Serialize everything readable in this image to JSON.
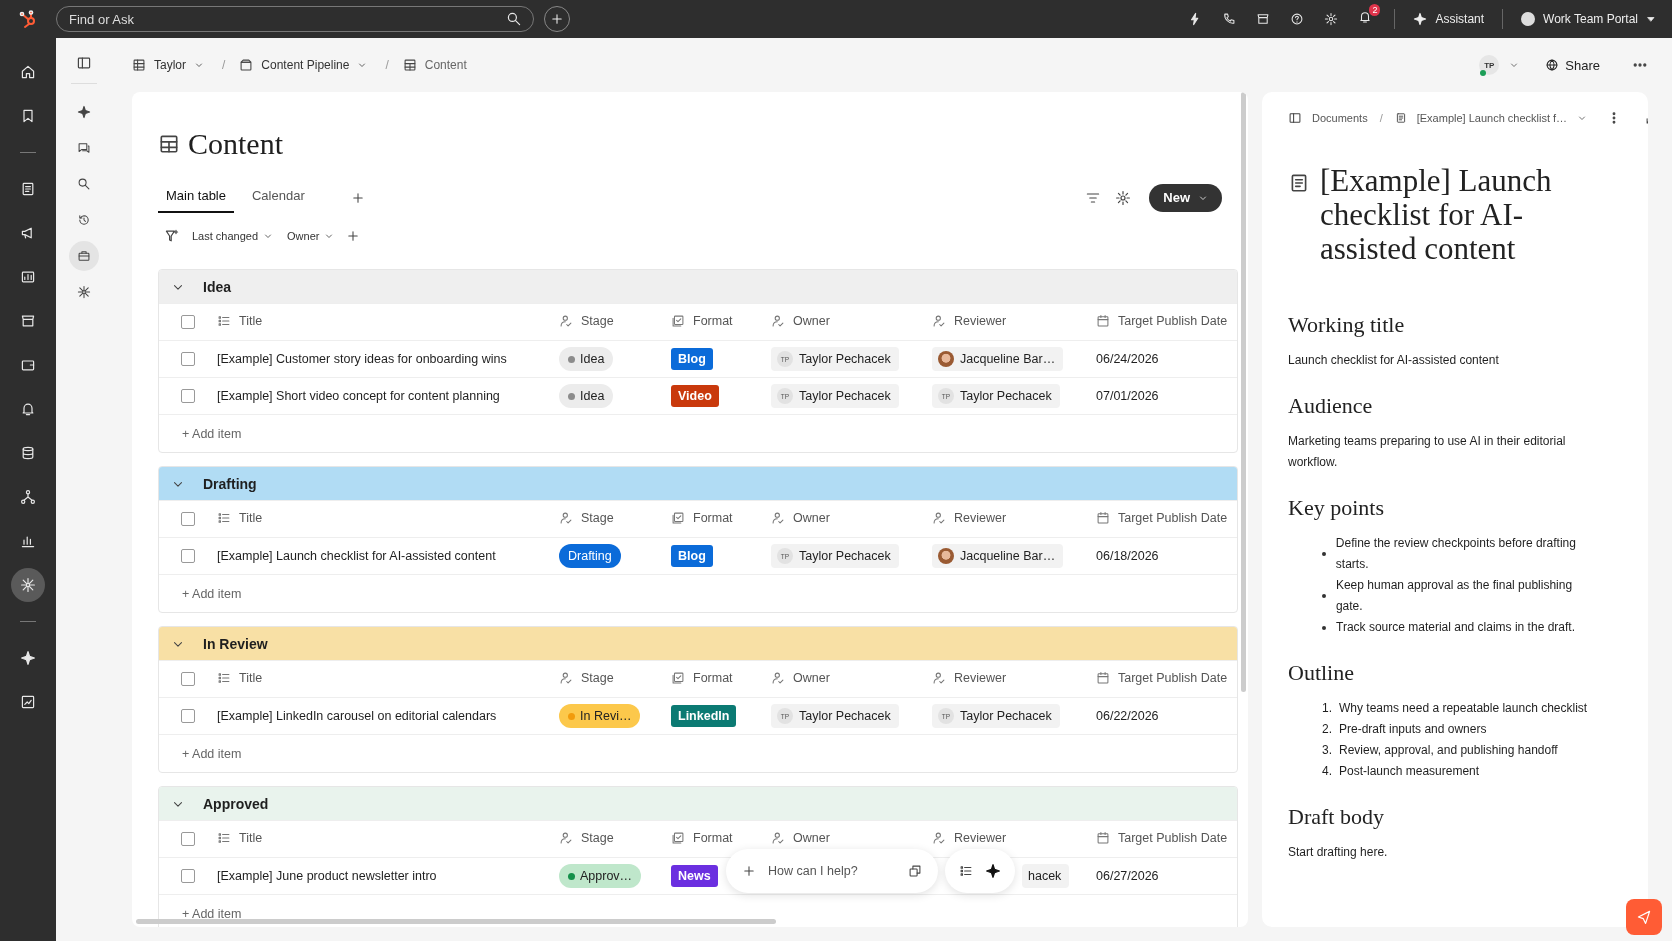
{
  "topbar": {
    "search_placeholder": "Find or Ask",
    "notification_count": "2",
    "assistant": "Assistant",
    "portal": "Work Team Portal"
  },
  "breadcrumb": [
    {
      "label": "Taylor",
      "dropdown": true
    },
    {
      "separator": "/",
      "label": "Content Pipeline",
      "dropdown": true
    },
    {
      "separator": "/",
      "label": "Content",
      "dropdown": false
    }
  ],
  "header": {
    "avatar": "TP",
    "share": "Share"
  },
  "page": {
    "title": "Content"
  },
  "tabs": [
    {
      "label": "Main table",
      "selected": true
    },
    {
      "label": "Calendar",
      "selected": false
    }
  ],
  "new_button": "New",
  "filters": [
    "Last changed",
    "Owner"
  ],
  "groups": [
    {
      "name": "Idea",
      "color": "#efefef",
      "expanded": true,
      "all_checked": false,
      "columns": [
        "Title",
        "Stage",
        "Format",
        "Owner",
        "Reviewer",
        "Target Publish Date"
      ],
      "add_label": "+ Add item",
      "rows": [
        {
          "checked": false,
          "title": "[Example] Customer story ideas for onboarding wins",
          "stage": {
            "label": "Idea",
            "color": "#ececec",
            "dot": {
              "color": "#8c8c8c"
            },
            "light": true
          },
          "format": {
            "label": "Blog",
            "color": "#0b6bd9"
          },
          "owner": {
            "initials": "TP",
            "name": "Taylor Pechacek"
          },
          "reviewer": {
            "kind": "photo",
            "name": "Jacqueline Bar…"
          },
          "date": "06/24/2026"
        },
        {
          "checked": false,
          "title": "[Example] Short video concept for content planning",
          "stage": {
            "label": "Idea",
            "color": "#ececec",
            "dot": {
              "color": "#8c8c8c"
            },
            "light": true
          },
          "format": {
            "label": "Video",
            "color": "#c9390c"
          },
          "owner": {
            "initials": "TP",
            "name": "Taylor Pechacek"
          },
          "reviewer": {
            "kind": "initials",
            "initials": "TP",
            "name": "Taylor Pechacek"
          },
          "date": "07/01/2026"
        }
      ]
    },
    {
      "name": "Drafting",
      "color": "#b1dcf4",
      "expanded": true,
      "all_checked": false,
      "columns": [
        "Title",
        "Stage",
        "Format",
        "Owner",
        "Reviewer",
        "Target Publish Date"
      ],
      "add_label": "+ Add item",
      "rows": [
        {
          "checked": false,
          "title": "[Example] Launch checklist for AI-assisted content",
          "stage": {
            "label": "Drafting",
            "color": "#0b6bd9",
            "light": false
          },
          "format": {
            "label": "Blog",
            "color": "#0b6bd9"
          },
          "owner": {
            "initials": "TP",
            "name": "Taylor Pechacek"
          },
          "reviewer": {
            "kind": "photo",
            "name": "Jacqueline Bar…"
          },
          "date": "06/18/2026"
        }
      ]
    },
    {
      "name": "In Review",
      "color": "#f8e0a5",
      "expanded": true,
      "all_checked": false,
      "columns": [
        "Title",
        "Stage",
        "Format",
        "Owner",
        "Reviewer",
        "Target Publish Date"
      ],
      "add_label": "+ Add item",
      "rows": [
        {
          "checked": false,
          "title": "[Example] LinkedIn carousel on editorial calendars",
          "stage": {
            "label": "In Revi…",
            "color": "#fcc84b",
            "dot": {
              "color": "#f29b0c"
            },
            "light": true
          },
          "format": {
            "label": "LinkedIn",
            "color": "#0b7a73"
          },
          "owner": {
            "initials": "TP",
            "name": "Taylor Pechacek"
          },
          "reviewer": {
            "kind": "initials",
            "initials": "TP",
            "name": "Taylor Pechacek"
          },
          "date": "06/22/2026"
        }
      ]
    },
    {
      "name": "Approved",
      "color": "#e9f3ed",
      "expanded": true,
      "all_checked": false,
      "columns": [
        "Title",
        "Stage",
        "Format",
        "Owner",
        "Reviewer",
        "Target Publish Date"
      ],
      "add_label": "+ Add item",
      "rows": [
        {
          "checked": false,
          "title": "[Example] June product newsletter intro",
          "stage": {
            "label": "Approv…",
            "color": "#bfe7cb",
            "dot": {
              "color": "#14904a"
            },
            "light": true
          },
          "format": {
            "label": "News",
            "color": "#6b2fe0"
          },
          "reviewer": {
            "kind": "clipped",
            "name": "hacek"
          },
          "date": "06/27/2026"
        }
      ]
    }
  ],
  "chat": {
    "placeholder": "How can I help?"
  },
  "document": {
    "breadcrumb": [
      {
        "label": "Documents"
      },
      {
        "separator": "/",
        "label": "[Example] Launch checklist f…"
      }
    ],
    "title": "[Example] Launch checklist for AI-assisted content",
    "sections": [
      {
        "heading": "Working title",
        "kind": "paragraph",
        "text": "Launch checklist for AI-assisted content"
      },
      {
        "heading": "Audience",
        "kind": "paragraph",
        "text": "Marketing teams preparing to use AI in their editorial workflow."
      },
      {
        "heading": "Key points",
        "kind": "bullets",
        "items": [
          {
            "text": "Define the review checkpoints before drafting starts."
          },
          {
            "text": "Keep human approval as the final publishing gate."
          },
          {
            "text": "Track source material and claims in the draft."
          }
        ]
      },
      {
        "heading": "Outline",
        "kind": "numbered",
        "items": [
          {
            "marker": "1.",
            "text": "Why teams need a repeatable launch checklist"
          },
          {
            "marker": "2.",
            "text": "Pre-draft inputs and owners"
          },
          {
            "marker": "3.",
            "text": "Review, approval, and publishing handoff"
          },
          {
            "marker": "4.",
            "text": "Post-launch measurement"
          }
        ]
      },
      {
        "heading": "Draft body",
        "kind": "paragraph",
        "text": "Start drafting here."
      }
    ]
  }
}
